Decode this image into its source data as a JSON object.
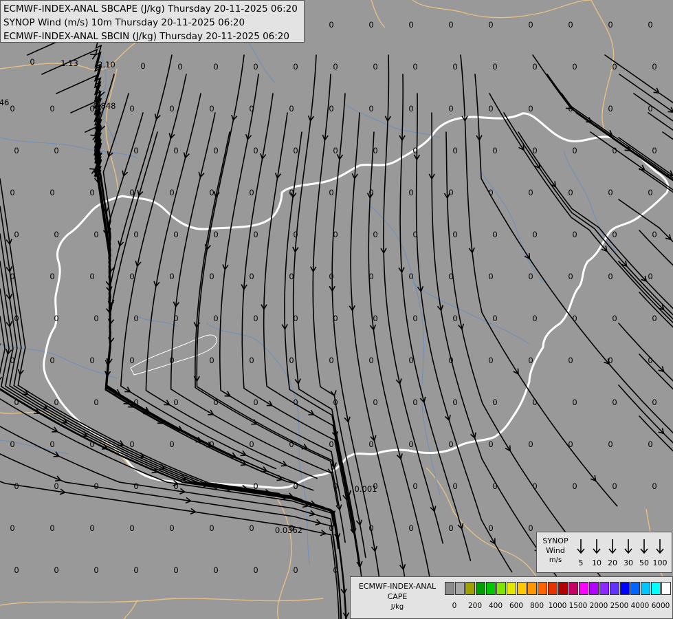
{
  "header": {
    "line1": "ECMWF-INDEX-ANAL SBCAPE (J/kg) Thursday 20-11-2025 06:20",
    "line2": "SYNOP Wind (m/s) 10m Thursday 20-11-2025 06:20",
    "line3": "ECMWF-INDEX-ANAL SBCIN (J/kg) Thursday 20-11-2025 06:20"
  },
  "synop_legend": {
    "title1": "SYNOP",
    "title2": "Wind",
    "title3": "m/s",
    "speeds": [
      "5",
      "10",
      "20",
      "30",
      "50",
      "100"
    ]
  },
  "cape_legend": {
    "title1": "ECMWF-INDEX-ANAL",
    "title2": "CAPE",
    "title3": "J/kg",
    "colors": [
      "#8c8c8c",
      "#a6a6a6",
      "#a0a000",
      "#00a000",
      "#00c800",
      "#80e600",
      "#e6e600",
      "#ffc800",
      "#ff9600",
      "#ff6400",
      "#e63200",
      "#b40000",
      "#c80064",
      "#ff00ff",
      "#b400ff",
      "#8c28ff",
      "#6432ff",
      "#0000ff",
      "#0064ff",
      "#00c8ff",
      "#00ffff",
      "#ffffff"
    ],
    "ticks": [
      "0",
      "200",
      "400",
      "600",
      "800",
      "1000",
      "1500",
      "2000",
      "2500",
      "4000",
      "6000"
    ]
  },
  "map_values": {
    "top_row": [
      "0",
      "1.13",
      "2.10",
      "0",
      "0"
    ],
    "left_a": "46",
    "left_b": "0.848",
    "mid_a": "0.001",
    "mid_b": "0.0362",
    "zero": "0"
  }
}
